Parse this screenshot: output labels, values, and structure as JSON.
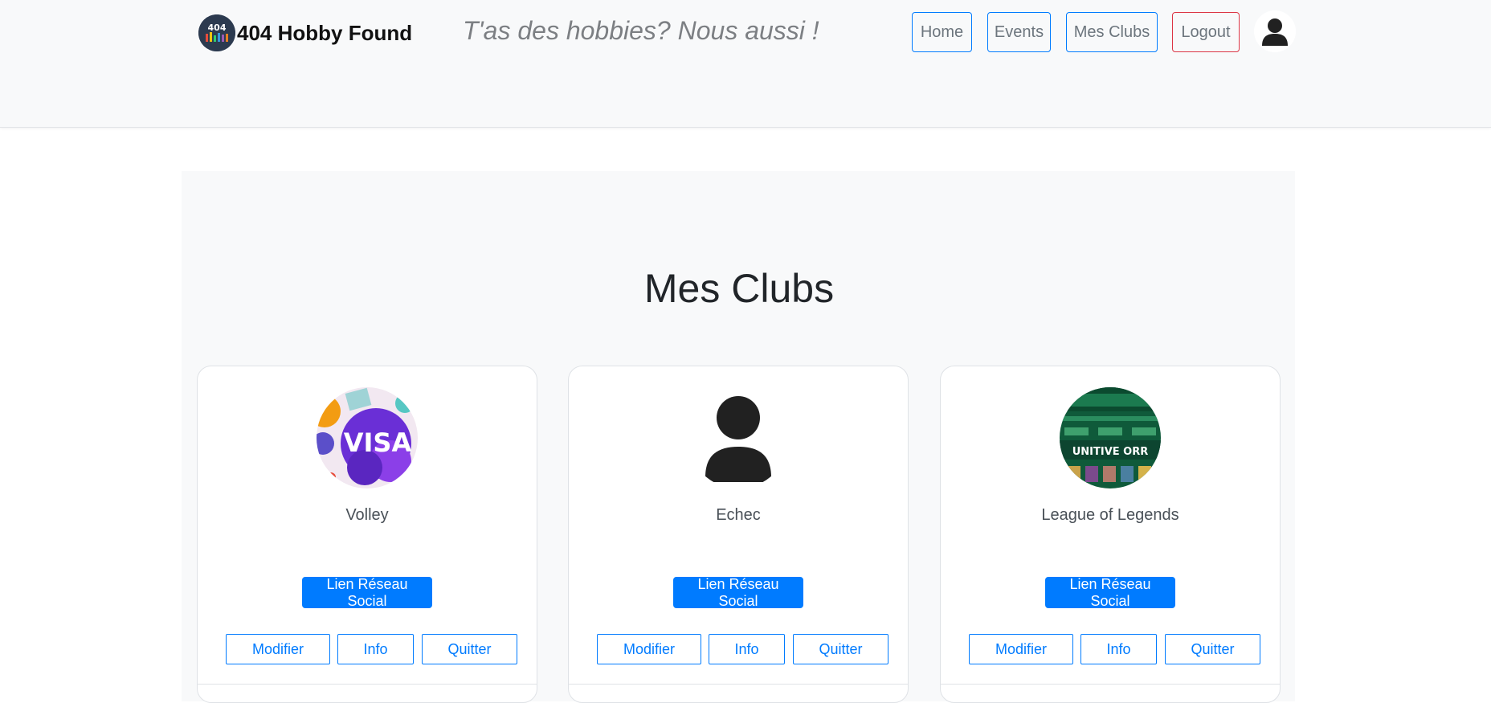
{
  "header": {
    "brand_name": "404 Hobby Found",
    "tagline": "T'as des hobbies? Nous aussi !",
    "logo_text": "404",
    "nav": {
      "home": "Home",
      "events": "Events",
      "clubs": "Mes Clubs",
      "logout": "Logout"
    },
    "avatar_icon": "user-avatar-icon"
  },
  "main": {
    "title": "Mes Clubs"
  },
  "clubs": [
    {
      "name": "Volley",
      "image_icon": "volley-club-image",
      "image_text": "VISA",
      "social_label": "Lien Réseau Social",
      "modify_label": "Modifier",
      "info_label": "Info",
      "quit_label": "Quitter"
    },
    {
      "name": "Echec",
      "image_icon": "default-user-icon",
      "social_label": "Lien Réseau Social",
      "modify_label": "Modifier",
      "info_label": "Info",
      "quit_label": "Quitter"
    },
    {
      "name": "League of Legends",
      "image_icon": "league-club-image",
      "image_text": "UNITIVE ORR",
      "social_label": "Lien Réseau Social",
      "modify_label": "Modifier",
      "info_label": "Info",
      "quit_label": "Quitter"
    }
  ],
  "colors": {
    "primary": "#007bff",
    "danger": "#dc3545",
    "navbar_bg": "#f8f9fa",
    "muted_text": "#6c757d"
  }
}
